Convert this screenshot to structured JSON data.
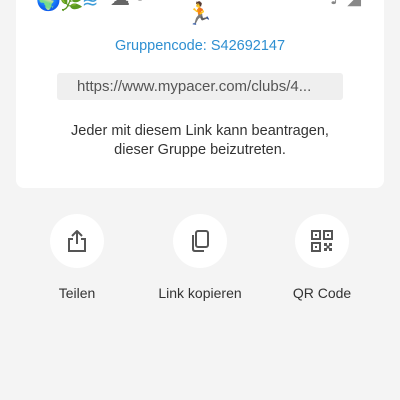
{
  "header": {
    "group_code": "Gruppencode: S42692147"
  },
  "share_link": {
    "value": "https://www.mypacer.com/clubs/4..."
  },
  "description": {
    "line1": "Jeder mit diesem Link kann beantragen,",
    "line2": "dieser Gruppe beizutreten."
  },
  "actions": [
    {
      "label": "Teilen",
      "icon": "share-icon"
    },
    {
      "label": "Link kopieren",
      "icon": "copy-icon"
    },
    {
      "label": "QR Code",
      "icon": "qr-code-icon"
    }
  ],
  "colors": {
    "accent": "#2e8fd1",
    "background": "#f4f4f4",
    "card": "#ffffff",
    "field": "#efefef"
  }
}
